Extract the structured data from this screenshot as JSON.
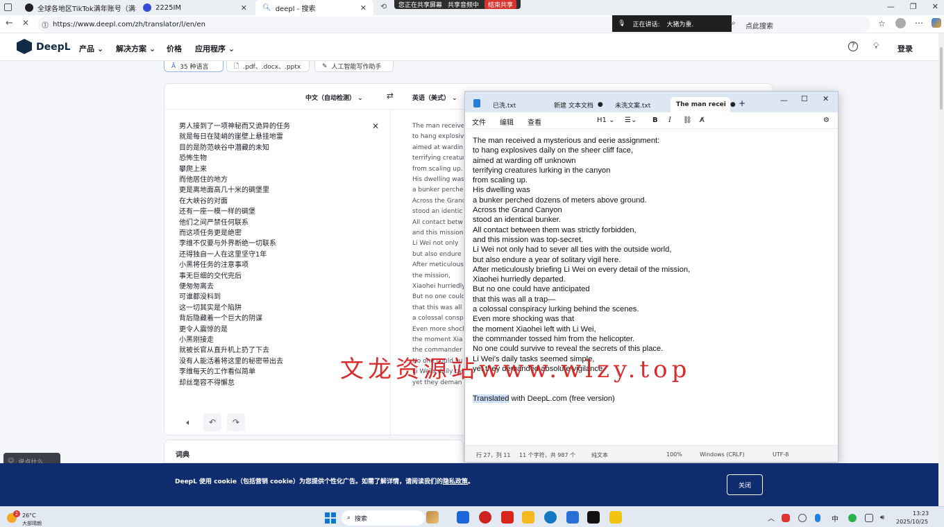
{
  "browser": {
    "tabs": [
      {
        "label": "全球各地区TikTok满年账号（满年",
        "color": "#222"
      },
      {
        "label": "2225IM",
        "color": "#3a4bd8"
      },
      {
        "label": "deepl - 搜索",
        "color": "#2b6cde"
      }
    ],
    "share_status": "您正在共享屏幕",
    "share_audio": "共享音频中",
    "stop_share": "结束共享",
    "url": "https://www.deepl.com/zh/translator/l/en/en",
    "voice_status": "正在讲话:",
    "voice_speaker": "大猪为重.",
    "search_placeholder": "点此搜索"
  },
  "deepl": {
    "logo": "DeepL",
    "nav": [
      "产品",
      "解决方案",
      "价格",
      "应用程序"
    ],
    "login": "登录",
    "chips": [
      "35 种语言",
      ".pdf、.docx、.pptx",
      "人工智能写作助手"
    ],
    "source_lang": "中文（自动检测）",
    "target_lang": "英语（美式）",
    "source_lines": [
      "男人接到了一项神秘而又诡异的任务",
      "就是每日在陡峭的崖壁上悬挂地雷",
      "目的是防范峡谷中潜藏的未知",
      "恐怖生物",
      "攀爬上来",
      "而他居住的地方",
      "更是离地面高几十米的碉堡里",
      "在大峡谷的对面",
      "还有一座一模一样的碉堡",
      "他们之间严禁任何联系",
      "而这项任务更是绝密",
      "李维不仅要与外界断绝一切联系",
      "还得独自一人在这里坚守1年",
      "小黑将任务的注意事项",
      "事无巨细的交代完后",
      "便匆匆离去",
      "可谁都没料到",
      "这一切其实是个陷阱",
      "背后隐藏着一个巨大的阴谋",
      "更令人震惊的是",
      "小黑刚接走",
      "就被长官从直升机上扔了下去",
      "没有人能活着将这里的秘密带出去",
      "李维每天的工作看似简单",
      "却丝毫容不得懈怠"
    ],
    "target_lines": [
      "The man received",
      "to hang explosiv",
      "aimed at wardin",
      "terrifying creatur",
      "from scaling up.",
      "His dwelling was",
      "a bunker perche",
      "Across the Grand",
      "stood an identic",
      "All contact betw",
      "and this mission",
      "Li Wei not only",
      "but also endure",
      "After meticulous",
      "the mission,",
      "Xiaohei hurriedly",
      "But no one could",
      "that this was all",
      "a colossal consp",
      "Even more shock",
      "the moment Xia",
      "the commander",
      "No one could su",
      "Li Wei's daily tas",
      "yet they deman"
    ],
    "dictionary": "词典",
    "cookie_text": "DeepL 使用 cookie（包括营销 cookie）为您提供个性化广告。如需了解详情，请阅读我们的",
    "cookie_link": "隐私政策",
    "cookie_close": "关闭",
    "say_something": "说点什么..."
  },
  "notepad": {
    "tabs": [
      "已洗.txt",
      "新建 文本文档",
      "未洗文案.txt",
      "The man recei"
    ],
    "menu": [
      "文件",
      "编辑",
      "查看"
    ],
    "heading_btn": "H1",
    "lines": [
      "The man received a mysterious and eerie assignment:",
      "to hang explosives daily on the sheer cliff face,",
      "aimed at warding off unknown",
      "terrifying creatures lurking in the canyon",
      "from scaling up.",
      "His dwelling was",
      "a bunker perched dozens of meters above ground.",
      "Across the Grand Canyon",
      "stood an identical bunker.",
      "All contact between them was strictly forbidden,",
      "and this mission was top-secret.",
      "Li Wei not only had to sever all ties with the outside world,",
      "but also endure a year of solitary vigil here.",
      "After meticulously briefing Li Wei on every detail of the mission,",
      "Xiaohei hurriedly departed.",
      "But no one could have anticipated",
      "that this was all a trap—",
      "a colossal conspiracy lurking behind the scenes.",
      "Even more shocking was that",
      "the moment Xiaohei left with Li Wei,",
      "the commander tossed him from the helicopter.",
      "No one could survive to reveal the secrets of this place.",
      "Li Wei's daily tasks seemed simple,",
      "yet they demanded absolute vigilance.",
      "",
      ""
    ],
    "credit_selected": "Translated",
    "credit_rest": " with DeepL.com (free version)",
    "status": {
      "position": "行 27，列 11",
      "chars": "11 个字符，共 987 个",
      "format": "纯文本",
      "zoom": "100%",
      "eol": "Windows (CRLF)",
      "encoding": "UTF-8"
    }
  },
  "watermark": "文龙资源站www.wlzy.top",
  "taskbar": {
    "weather_temp": "26°C",
    "weather_desc": "大部晴朗",
    "badge": "2",
    "search": "搜索",
    "time": "13:23",
    "date": "2025/10/25",
    "ime": "中"
  }
}
